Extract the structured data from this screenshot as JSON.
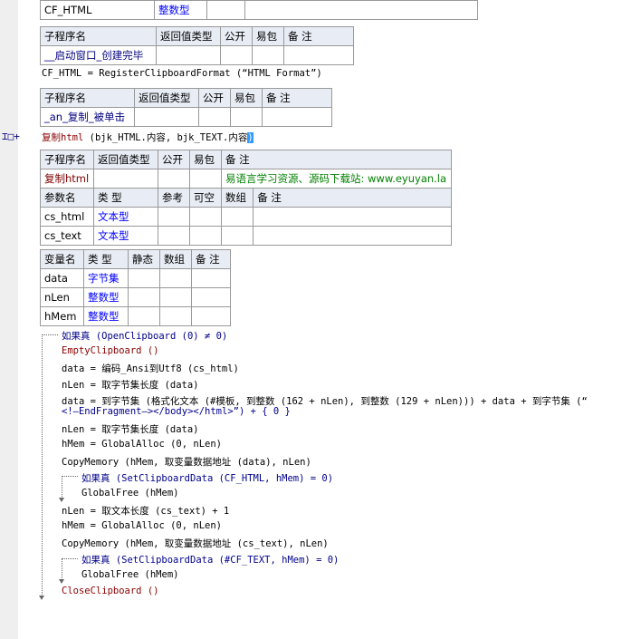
{
  "top_table": {
    "row": [
      "CF_HTML",
      "整数型",
      "",
      ""
    ]
  },
  "sub1": {
    "headers": [
      "子程序名",
      "返回值类型",
      "公开",
      "易包",
      "备 注"
    ],
    "row": [
      "__启动窗口_创建完毕",
      "",
      "",
      "",
      ""
    ]
  },
  "line_cfhtml": "CF_HTML = RegisterClipboardFormat (“HTML Format”)",
  "sub2": {
    "headers": [
      "子程序名",
      "返回值类型",
      "公开",
      "易包",
      "备 注"
    ],
    "row": [
      "_an_复制_被单击",
      "",
      "",
      "",
      ""
    ]
  },
  "gutter_marker": "⌶□+",
  "call_line": {
    "fn": "复制html",
    "args": "(bjk_HTML.内容, bjk_TEXT.内容)",
    "args_pre": "(bjk_HTML.内容, bjk_TEXT.内容",
    "args_sel": ")"
  },
  "sub3": {
    "headers": [
      "子程序名",
      "返回值类型",
      "公开",
      "易包",
      "备 注"
    ],
    "row": [
      "复制html",
      "",
      "",
      "",
      "易语言学习资源、源码下载站: www.eyuyan.la"
    ],
    "param_headers": [
      "参数名",
      "类 型",
      "参考",
      "可空",
      "数组",
      "备 注"
    ],
    "params": [
      [
        "cs_html",
        "文本型",
        "",
        "",
        "",
        ""
      ],
      [
        "cs_text",
        "文本型",
        "",
        "",
        "",
        ""
      ]
    ]
  },
  "vars": {
    "headers": [
      "变量名",
      "类 型",
      "静态",
      "数组",
      "备 注"
    ],
    "rows": [
      [
        "data",
        "字节集",
        "",
        "",
        ""
      ],
      [
        "nLen",
        "整数型",
        "",
        "",
        ""
      ],
      [
        "hMem",
        "整数型",
        "",
        "",
        ""
      ]
    ]
  },
  "code": [
    "如果真 (OpenClipboard (0) ≠ 0)",
    "EmptyClipboard ()",
    "data = 编码_Ansi到Utf8 (cs_html)",
    "nLen = 取字节集长度 (data)",
    "data = 到字节集 (格式化文本 (#模板, 到整数 (162 + nLen), 到整数 (129 + nLen))) + data + 到字节集 (“",
    "<!—EndFragment—></body></html>”) + { 0 }",
    "nLen = 取字节集长度 (data)",
    "hMem = GlobalAlloc (0, nLen)",
    "CopyMemory (hMem, 取变量数据地址 (data), nLen)",
    "如果真 (SetClipboardData (CF_HTML, hMem) = 0)",
    "GlobalFree (hMem)",
    "nLen = 取文本长度 (cs_text) + 1",
    "hMem = GlobalAlloc (0, nLen)",
    "CopyMemory (hMem, 取变量数据地址 (cs_text), nLen)",
    "如果真 (SetClipboardData (#CF_TEXT, hMem) = 0)",
    "GlobalFree (hMem)",
    "CloseClipboard ()"
  ]
}
